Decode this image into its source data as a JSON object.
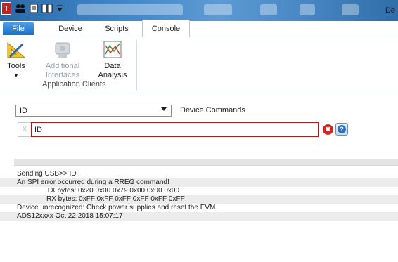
{
  "titlebar": {
    "app_icon_letter": "T",
    "window_title": "De",
    "quick_access": [
      "people-icon",
      "document-icon",
      "book-icon",
      "customize-dropdown-icon"
    ]
  },
  "tabs": [
    {
      "label": "File",
      "active": false
    },
    {
      "label": "Device",
      "active": false
    },
    {
      "label": "Scripts",
      "active": false
    },
    {
      "label": "Console",
      "active": true
    }
  ],
  "ribbon": {
    "buttons": [
      {
        "label": "Tools",
        "icon": "tools-icon",
        "enabled": true
      },
      {
        "label": "Additional\nInterfaces",
        "icon": "interfaces-icon",
        "enabled": false
      },
      {
        "label": "Data\nAnalysis",
        "icon": "data-analysis-icon",
        "enabled": true
      }
    ],
    "group_label": "Application Clients"
  },
  "command_panel": {
    "selected_command": "ID",
    "device_commands_label": "Device Commands",
    "clear_label": "X",
    "input_value": "ID",
    "error_icon_glyph": "✖",
    "help_icon_glyph": "?"
  },
  "console": {
    "lines": [
      {
        "text": "Sending USB>> ID",
        "indent": false
      },
      {
        "text": "An SPI error occurred during a RREG command!",
        "indent": false
      },
      {
        "text": "TX bytes: 0x20 0x00 0x79 0x00 0x00 0x00",
        "indent": true
      },
      {
        "text": "RX bytes: 0xFF 0xFF 0xFF 0xFF 0xFF 0xFF",
        "indent": true
      },
      {
        "text": "Device unrecognized: Check power supplies and reset the EVM.",
        "indent": false
      },
      {
        "text": "ADS12xxxx Oct 22 2018 15:07:17",
        "indent": false
      }
    ]
  },
  "colors": {
    "title_gradient_start": "#2c6aa5",
    "file_tab": "#1a6fc7",
    "error_red": "#d0261f",
    "input_border_error": "#b11a1a",
    "console_shade": "#ececec"
  }
}
